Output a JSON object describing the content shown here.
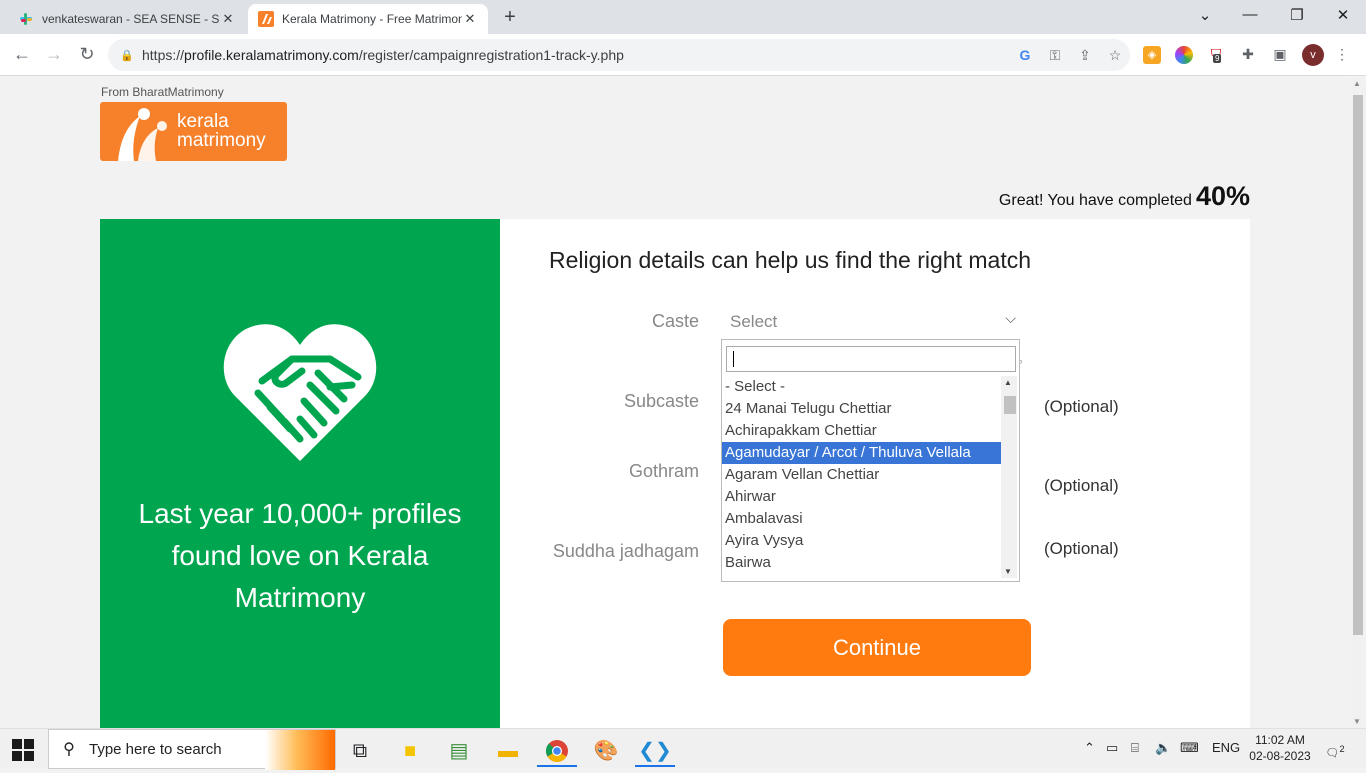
{
  "browser": {
    "tabs": [
      {
        "title": "venkateswaran - SEA SENSE - Slack",
        "active": false
      },
      {
        "title": "Kerala Matrimony - Free Matrimony",
        "active": true
      }
    ],
    "url_prefix": "https://",
    "url_domain": "profile.keralamatrimony.com",
    "url_path": "/register/campaignregistration1-track-y.php",
    "profile_initial": "v",
    "extension_badge": "9"
  },
  "page": {
    "from_text": "From BharatMatrimony",
    "logo_line1": "kerala",
    "logo_line2": "matrimony",
    "progress_text": "Great! You have completed",
    "progress_value": "40%",
    "left_message": "Last year 10,000+ profiles found love on Kerala Matrimony",
    "heading": "Religion details can help us find the right match",
    "fields": {
      "caste_label": "Caste",
      "caste_value": "Select",
      "subcaste_label": "Subcaste",
      "gothram_label": "Gothram",
      "suddha_label": "Suddha jadhagam",
      "optional": "(Optional)"
    },
    "dropdown": {
      "search_value": "",
      "options": [
        "- Select -",
        "24 Manai Telugu Chettiar",
        "Achirapakkam Chettiar",
        "Agamudayar / Arcot / Thuluva Vellala",
        "Agaram Vellan Chettiar",
        "Ahirwar",
        "Ambalavasi",
        "Ayira Vysya",
        "Bairwa"
      ],
      "highlighted": "Agamudayar / Arcot / Thuluva Vellala"
    },
    "continue_label": "Continue"
  },
  "taskbar": {
    "search_placeholder": "Type here to search",
    "language": "ENG",
    "time": "11:02 AM",
    "date": "02-08-2023",
    "notifications": "2"
  },
  "colors": {
    "green": "#00a64f",
    "orange": "#ff7b0f",
    "highlight": "#3875d7"
  }
}
